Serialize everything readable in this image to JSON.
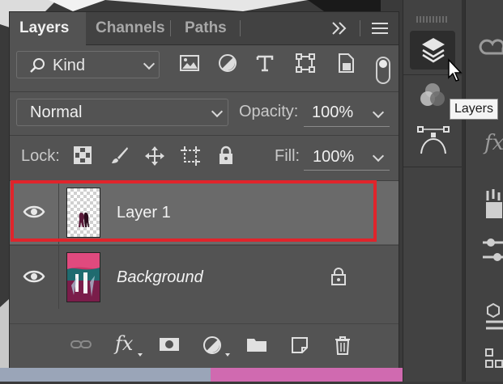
{
  "tabs": [
    {
      "label": "Layers",
      "active": true
    },
    {
      "label": "Channels",
      "active": false
    },
    {
      "label": "Paths",
      "active": false
    }
  ],
  "tab_icons": {
    "collapse": "double-chevron-right-icon",
    "menu": "hamburger-menu-icon"
  },
  "filter": {
    "kind_label": "Kind",
    "icons": [
      "pixel-layer-filter-icon",
      "adjustment-layer-filter-icon",
      "type-layer-filter-icon",
      "shape-layer-filter-icon",
      "smart-object-filter-icon"
    ],
    "toggle_on": true
  },
  "blend": {
    "mode": "Normal",
    "opacity_label": "Opacity:",
    "opacity_value": "100%"
  },
  "lock": {
    "label": "Lock:",
    "icons": [
      "lock-transparent-pixels-icon",
      "lock-image-pixels-icon",
      "lock-position-icon",
      "lock-artboard-icon",
      "lock-all-icon"
    ],
    "fill_label": "Fill:",
    "fill_value": "100%"
  },
  "layers": [
    {
      "name": "Layer 1",
      "visible": true,
      "selected": true,
      "italic": false,
      "locked": false
    },
    {
      "name": "Background",
      "visible": true,
      "selected": false,
      "italic": true,
      "locked": true
    }
  ],
  "footer_icons": [
    "link-layers-icon",
    "fx-layer-style-icon",
    "add-mask-icon",
    "adjustment-layer-icon",
    "new-group-folder-icon",
    "new-layer-icon",
    "trash-icon"
  ],
  "footer_fx_label": "fx",
  "dock": {
    "tooltip": "Layers",
    "icons": [
      "layers-panel-icon",
      "color-channels-icon",
      "paths-panel-icon"
    ]
  },
  "colors": {
    "panel": "#535353",
    "tabbar": "#424242",
    "selected_row": "#6a6a6a",
    "highlight": "#e0242b"
  }
}
